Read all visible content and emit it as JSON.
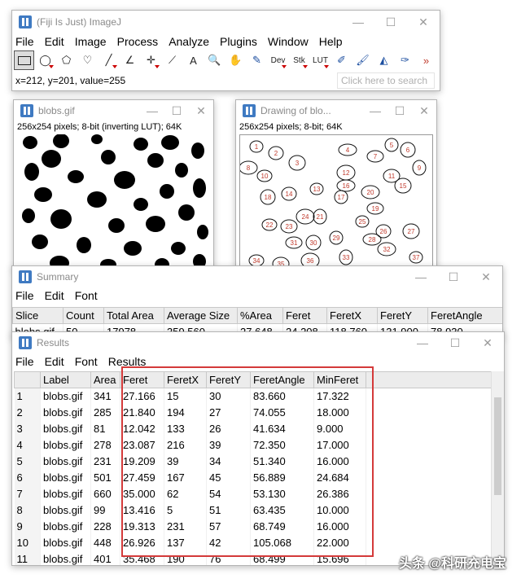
{
  "imagej": {
    "title": "(Fiji Is Just) ImageJ",
    "menus": [
      "File",
      "Edit",
      "Image",
      "Process",
      "Analyze",
      "Plugins",
      "Window",
      "Help"
    ],
    "tools": [
      {
        "icon": "rectangle-select-icon",
        "glyph": "",
        "selected": true
      },
      {
        "icon": "oval-select-icon",
        "glyph": "◯",
        "dropdown": true
      },
      {
        "icon": "polygon-select-icon",
        "glyph": "⬠"
      },
      {
        "icon": "freehand-select-icon",
        "glyph": "♡"
      },
      {
        "icon": "line-tool-icon",
        "glyph": "╱",
        "dropdown": true
      },
      {
        "icon": "angle-tool-icon",
        "glyph": "∠"
      },
      {
        "icon": "point-tool-icon",
        "glyph": "✛",
        "dropdown": true
      },
      {
        "icon": "wand-tool-icon",
        "glyph": "⟋"
      },
      {
        "icon": "text-tool-icon",
        "glyph": "A"
      },
      {
        "icon": "magnifier-icon",
        "glyph": "🔍"
      },
      {
        "icon": "scroll-hand-icon",
        "glyph": "✋"
      },
      {
        "icon": "color-picker-icon",
        "glyph": "✎"
      },
      {
        "icon": "dev-menu-icon",
        "glyph": "Dev",
        "dropdown": true
      },
      {
        "icon": "stk-menu-icon",
        "glyph": "Stk",
        "dropdown": true
      },
      {
        "icon": "lut-menu-icon",
        "glyph": "LUT",
        "dropdown": true
      },
      {
        "icon": "pencil-icon",
        "glyph": "✐"
      },
      {
        "icon": "brush-icon",
        "glyph": "🖌"
      },
      {
        "icon": "flood-fill-icon",
        "glyph": "◭"
      },
      {
        "icon": "paintbrush-icon",
        "glyph": "✑"
      },
      {
        "icon": "more-tools-icon",
        "glyph": "»"
      }
    ],
    "status": "x=212, y=201, value=255",
    "search_placeholder": "Click here to search"
  },
  "blobs_window": {
    "title": "blobs.gif",
    "info": "256x254 pixels; 8-bit (inverting LUT); 64K"
  },
  "drawing_window": {
    "title": "Drawing of blo...",
    "info": "256x254 pixels; 8-bit; 64K",
    "labels": [
      "1",
      "2",
      "3",
      "4",
      "5",
      "6",
      "7",
      "8",
      "9",
      "10",
      "11",
      "12",
      "13",
      "14",
      "15",
      "16",
      "17",
      "18",
      "19",
      "20",
      "21",
      "22",
      "23",
      "24",
      "25",
      "26",
      "27",
      "28",
      "29",
      "30",
      "31",
      "32",
      "33",
      "34",
      "35",
      "36",
      "37"
    ]
  },
  "summary_window": {
    "title": "Summary",
    "menus": [
      "File",
      "Edit",
      "Font"
    ],
    "columns": [
      "Slice",
      "Count",
      "Total Area",
      "Average Size",
      "%Area",
      "Feret",
      "FeretX",
      "FeretY",
      "FeretAngle"
    ],
    "row": [
      "blobs.gif",
      "50",
      "17978",
      "359.560",
      "27.648",
      "24.208",
      "118.760",
      "131.900",
      "78.930"
    ]
  },
  "results_window": {
    "title": "Results",
    "menus": [
      "File",
      "Edit",
      "Font",
      "Results"
    ],
    "columns": [
      "",
      "Label",
      "Area",
      "Feret",
      "FeretX",
      "FeretY",
      "FeretAngle",
      "MinFeret"
    ],
    "rows": [
      [
        "1",
        "blobs.gif",
        "341",
        "27.166",
        "15",
        "30",
        "83.660",
        "17.322"
      ],
      [
        "2",
        "blobs.gif",
        "285",
        "21.840",
        "194",
        "27",
        "74.055",
        "18.000"
      ],
      [
        "3",
        "blobs.gif",
        "81",
        "12.042",
        "133",
        "26",
        "41.634",
        "9.000"
      ],
      [
        "4",
        "blobs.gif",
        "278",
        "23.087",
        "216",
        "39",
        "72.350",
        "17.000"
      ],
      [
        "5",
        "blobs.gif",
        "231",
        "19.209",
        "39",
        "34",
        "51.340",
        "16.000"
      ],
      [
        "6",
        "blobs.gif",
        "501",
        "27.459",
        "167",
        "45",
        "56.889",
        "24.684"
      ],
      [
        "7",
        "blobs.gif",
        "660",
        "35.000",
        "62",
        "54",
        "53.130",
        "26.386"
      ],
      [
        "8",
        "blobs.gif",
        "99",
        "13.416",
        "5",
        "51",
        "63.435",
        "10.000"
      ],
      [
        "9",
        "blobs.gif",
        "228",
        "19.313",
        "231",
        "57",
        "68.749",
        "16.000"
      ],
      [
        "10",
        "blobs.gif",
        "448",
        "26.926",
        "137",
        "42",
        "105.068",
        "22.000"
      ],
      [
        "11",
        "blobs.gif",
        "401",
        "35.468",
        "190",
        "76",
        "68.499",
        "15.696"
      ]
    ]
  },
  "watermark": "头条 @科研充电宝",
  "colors": {
    "highlight": "#d43a3a",
    "fiji_blue": "#3f7ac2",
    "label_red": "#c0392b"
  }
}
